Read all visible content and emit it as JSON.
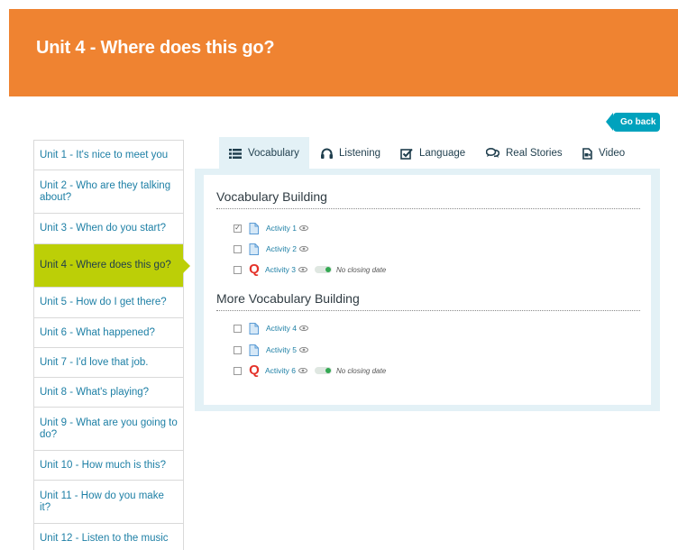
{
  "header": {
    "title": "Unit 4 - Where does this go?"
  },
  "go_back": {
    "label": "Go back"
  },
  "sidebar": {
    "items": [
      {
        "label": "Unit 1 - It's nice to meet you",
        "active": false
      },
      {
        "label": "Unit 2 - Who are they talking about?",
        "active": false
      },
      {
        "label": "Unit 3 - When do you start?",
        "active": false
      },
      {
        "label": "Unit 4 - Where does this go?",
        "active": true
      },
      {
        "label": "Unit 5 - How do I get there?",
        "active": false
      },
      {
        "label": "Unit 6 - What happened?",
        "active": false
      },
      {
        "label": "Unit 7 - I'd love that job.",
        "active": false
      },
      {
        "label": "Unit 8 - What's playing?",
        "active": false
      },
      {
        "label": "Unit 9 - What are you going to do?",
        "active": false
      },
      {
        "label": "Unit 10 - How much is this?",
        "active": false
      },
      {
        "label": "Unit 11 - How do you make it?",
        "active": false
      },
      {
        "label": "Unit 12 - Listen to the music",
        "active": false
      }
    ]
  },
  "tabs": [
    {
      "label": "Vocabulary",
      "icon": "list-icon",
      "active": true
    },
    {
      "label": "Listening",
      "icon": "headphones-icon",
      "active": false
    },
    {
      "label": "Language",
      "icon": "checkbox-edit-icon",
      "active": false
    },
    {
      "label": "Real Stories",
      "icon": "chat-bubbles-icon",
      "active": false
    },
    {
      "label": "Video",
      "icon": "video-file-icon",
      "active": false
    }
  ],
  "sections": [
    {
      "title": "Vocabulary Building",
      "activities": [
        {
          "label": "Activity 1",
          "type": "document",
          "checked": true
        },
        {
          "label": "Activity 2",
          "type": "document",
          "checked": false
        },
        {
          "label": "Activity 3",
          "type": "quiz",
          "checked": false,
          "closing": "No closing date"
        }
      ]
    },
    {
      "title": "More Vocabulary Building",
      "activities": [
        {
          "label": "Activity 4",
          "type": "document",
          "checked": false
        },
        {
          "label": "Activity 5",
          "type": "document",
          "checked": false
        },
        {
          "label": "Activity 6",
          "type": "quiz",
          "checked": false,
          "closing": "No closing date"
        }
      ]
    }
  ],
  "colors": {
    "header": "#ef8331",
    "accent": "#00a2bd",
    "active_unit": "#bccf07",
    "link": "#1d7fa5",
    "panel": "#e3f1f6",
    "quiz": "#e43128"
  }
}
